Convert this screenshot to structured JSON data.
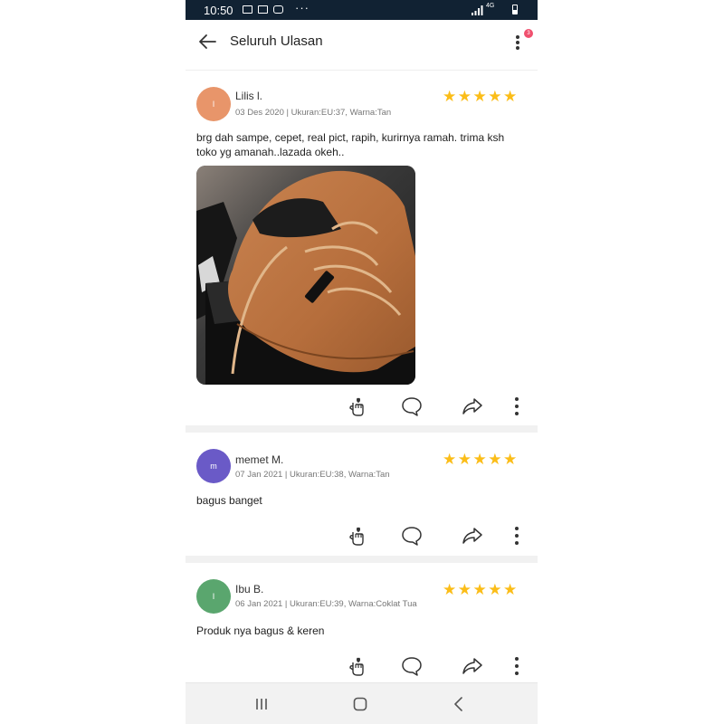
{
  "status_bar": {
    "time": "10:50",
    "network": "4G"
  },
  "header": {
    "title": "Seluruh Ulasan",
    "badge_count": "3"
  },
  "reviews": [
    {
      "avatar_letter": "l",
      "avatar_color": "#e8956a",
      "name": "Lilis l.",
      "meta": "03 Des 2020 | Ukuran:EU:37, Warna:Tan",
      "rating": "★★★★★",
      "text": "brg dah sampe, cepet, real pict, rapih, kurirnya ramah. trima ksh toko yg amanah..lazada okeh..",
      "photo": "shoe-photo"
    },
    {
      "avatar_letter": "m",
      "avatar_color": "#6a5ac7",
      "name": "memet M.",
      "meta": "07 Jan 2021 | Ukuran:EU:38, Warna:Tan",
      "rating": "★★★★★",
      "text": "bagus banget"
    },
    {
      "avatar_letter": "I",
      "avatar_color": "#5aa66e",
      "name": "Ibu B.",
      "meta": "06 Jan 2021 | Ukuran:EU:39, Warna:Coklat Tua",
      "rating": "★★★★★",
      "text": "Produk nya bagus & keren"
    }
  ],
  "actions": [
    "like-icon",
    "comment-icon",
    "share-icon",
    "more-vertical-icon"
  ],
  "nav": [
    "recent-apps-icon",
    "home-icon",
    "back-icon"
  ],
  "colors": {
    "star": "#fbbd18",
    "status_bar": "#112233",
    "badge": "#f0506e"
  }
}
